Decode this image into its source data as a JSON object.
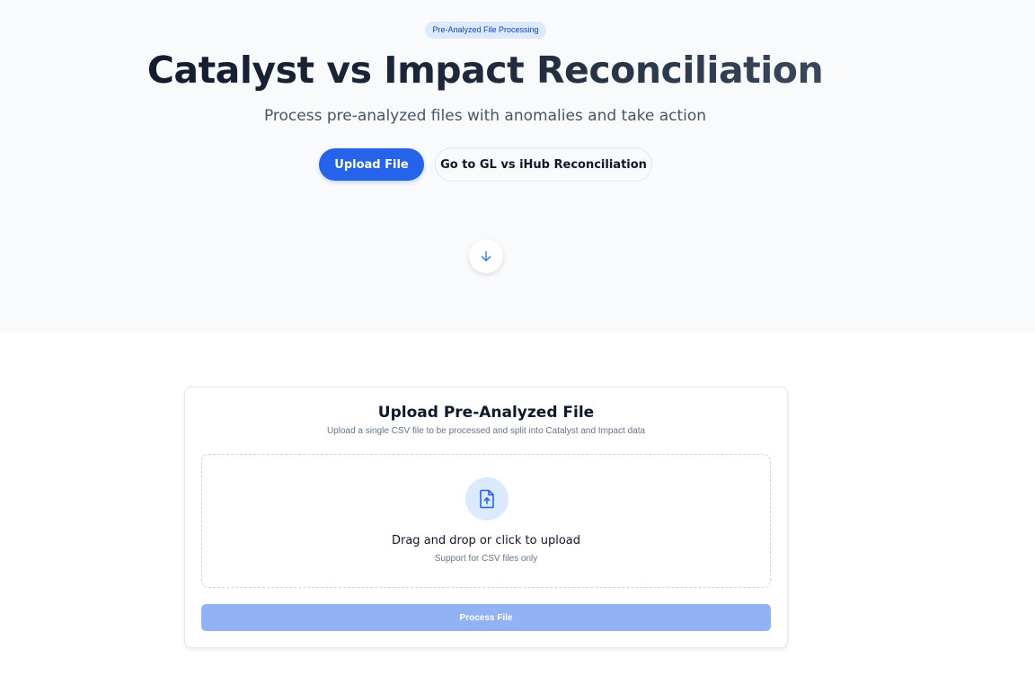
{
  "hero": {
    "badge": "Pre-Analyzed File Processing",
    "title": "Catalyst vs Impact Reconciliation",
    "subtitle": "Process pre-analyzed files with anomalies and take action",
    "upload_button": "Upload File",
    "secondary_button": "Go to GL vs iHub Reconciliation",
    "scroll_icon": "arrow-down-icon"
  },
  "upload_card": {
    "title": "Upload Pre-Analyzed File",
    "description": "Upload a single CSV file to be processed and split into Catalyst and Impact data",
    "dropzone_icon": "file-upload-icon",
    "dropzone_title": "Drag and drop or click to upload",
    "dropzone_hint": "Support for CSV files only",
    "process_button": "Process File",
    "process_button_disabled": true
  },
  "colors": {
    "accent": "#2563eb",
    "accent_light": "#dbeafe",
    "disabled_button": "#93b2f5",
    "hero_background": "#f8fafc"
  }
}
